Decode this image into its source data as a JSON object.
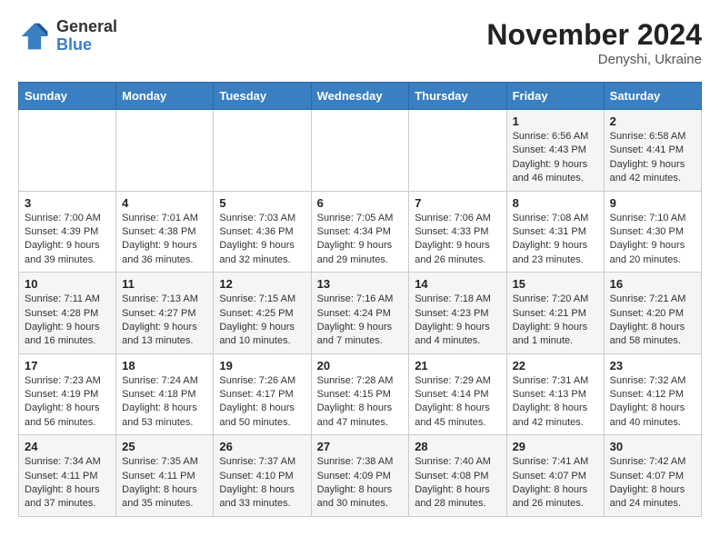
{
  "header": {
    "logo": {
      "text_general": "General",
      "text_blue": "Blue"
    },
    "title": "November 2024",
    "location": "Denyshi, Ukraine"
  },
  "calendar": {
    "days_of_week": [
      "Sunday",
      "Monday",
      "Tuesday",
      "Wednesday",
      "Thursday",
      "Friday",
      "Saturday"
    ],
    "weeks": [
      [
        {
          "day": "",
          "info": ""
        },
        {
          "day": "",
          "info": ""
        },
        {
          "day": "",
          "info": ""
        },
        {
          "day": "",
          "info": ""
        },
        {
          "day": "",
          "info": ""
        },
        {
          "day": "1",
          "info": "Sunrise: 6:56 AM\nSunset: 4:43 PM\nDaylight: 9 hours and 46 minutes."
        },
        {
          "day": "2",
          "info": "Sunrise: 6:58 AM\nSunset: 4:41 PM\nDaylight: 9 hours and 42 minutes."
        }
      ],
      [
        {
          "day": "3",
          "info": "Sunrise: 7:00 AM\nSunset: 4:39 PM\nDaylight: 9 hours and 39 minutes."
        },
        {
          "day": "4",
          "info": "Sunrise: 7:01 AM\nSunset: 4:38 PM\nDaylight: 9 hours and 36 minutes."
        },
        {
          "day": "5",
          "info": "Sunrise: 7:03 AM\nSunset: 4:36 PM\nDaylight: 9 hours and 32 minutes."
        },
        {
          "day": "6",
          "info": "Sunrise: 7:05 AM\nSunset: 4:34 PM\nDaylight: 9 hours and 29 minutes."
        },
        {
          "day": "7",
          "info": "Sunrise: 7:06 AM\nSunset: 4:33 PM\nDaylight: 9 hours and 26 minutes."
        },
        {
          "day": "8",
          "info": "Sunrise: 7:08 AM\nSunset: 4:31 PM\nDaylight: 9 hours and 23 minutes."
        },
        {
          "day": "9",
          "info": "Sunrise: 7:10 AM\nSunset: 4:30 PM\nDaylight: 9 hours and 20 minutes."
        }
      ],
      [
        {
          "day": "10",
          "info": "Sunrise: 7:11 AM\nSunset: 4:28 PM\nDaylight: 9 hours and 16 minutes."
        },
        {
          "day": "11",
          "info": "Sunrise: 7:13 AM\nSunset: 4:27 PM\nDaylight: 9 hours and 13 minutes."
        },
        {
          "day": "12",
          "info": "Sunrise: 7:15 AM\nSunset: 4:25 PM\nDaylight: 9 hours and 10 minutes."
        },
        {
          "day": "13",
          "info": "Sunrise: 7:16 AM\nSunset: 4:24 PM\nDaylight: 9 hours and 7 minutes."
        },
        {
          "day": "14",
          "info": "Sunrise: 7:18 AM\nSunset: 4:23 PM\nDaylight: 9 hours and 4 minutes."
        },
        {
          "day": "15",
          "info": "Sunrise: 7:20 AM\nSunset: 4:21 PM\nDaylight: 9 hours and 1 minute."
        },
        {
          "day": "16",
          "info": "Sunrise: 7:21 AM\nSunset: 4:20 PM\nDaylight: 8 hours and 58 minutes."
        }
      ],
      [
        {
          "day": "17",
          "info": "Sunrise: 7:23 AM\nSunset: 4:19 PM\nDaylight: 8 hours and 56 minutes."
        },
        {
          "day": "18",
          "info": "Sunrise: 7:24 AM\nSunset: 4:18 PM\nDaylight: 8 hours and 53 minutes."
        },
        {
          "day": "19",
          "info": "Sunrise: 7:26 AM\nSunset: 4:17 PM\nDaylight: 8 hours and 50 minutes."
        },
        {
          "day": "20",
          "info": "Sunrise: 7:28 AM\nSunset: 4:15 PM\nDaylight: 8 hours and 47 minutes."
        },
        {
          "day": "21",
          "info": "Sunrise: 7:29 AM\nSunset: 4:14 PM\nDaylight: 8 hours and 45 minutes."
        },
        {
          "day": "22",
          "info": "Sunrise: 7:31 AM\nSunset: 4:13 PM\nDaylight: 8 hours and 42 minutes."
        },
        {
          "day": "23",
          "info": "Sunrise: 7:32 AM\nSunset: 4:12 PM\nDaylight: 8 hours and 40 minutes."
        }
      ],
      [
        {
          "day": "24",
          "info": "Sunrise: 7:34 AM\nSunset: 4:11 PM\nDaylight: 8 hours and 37 minutes."
        },
        {
          "day": "25",
          "info": "Sunrise: 7:35 AM\nSunset: 4:11 PM\nDaylight: 8 hours and 35 minutes."
        },
        {
          "day": "26",
          "info": "Sunrise: 7:37 AM\nSunset: 4:10 PM\nDaylight: 8 hours and 33 minutes."
        },
        {
          "day": "27",
          "info": "Sunrise: 7:38 AM\nSunset: 4:09 PM\nDaylight: 8 hours and 30 minutes."
        },
        {
          "day": "28",
          "info": "Sunrise: 7:40 AM\nSunset: 4:08 PM\nDaylight: 8 hours and 28 minutes."
        },
        {
          "day": "29",
          "info": "Sunrise: 7:41 AM\nSunset: 4:07 PM\nDaylight: 8 hours and 26 minutes."
        },
        {
          "day": "30",
          "info": "Sunrise: 7:42 AM\nSunset: 4:07 PM\nDaylight: 8 hours and 24 minutes."
        }
      ]
    ]
  }
}
